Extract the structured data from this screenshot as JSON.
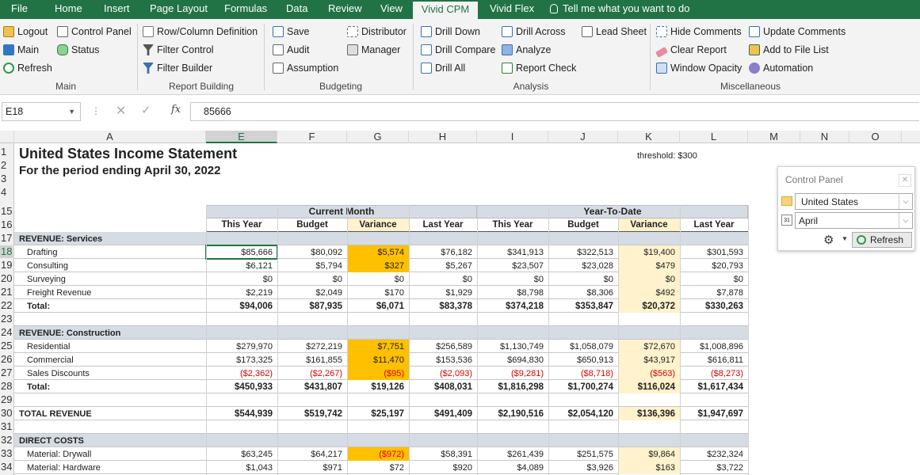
{
  "menubar": {
    "tabs": [
      "File",
      "Home",
      "Insert",
      "Page Layout",
      "Formulas",
      "Data",
      "Review",
      "View",
      "Vivid CPM",
      "Vivid Flex"
    ],
    "active_tab": "Vivid CPM",
    "tell_me": "Tell me what you want to do"
  },
  "ribbon": {
    "main": {
      "logout": "Logout",
      "main": "Main",
      "refresh": "Refresh",
      "control_panel": "Control Panel",
      "status": "Status",
      "group": "Main"
    },
    "report_building": {
      "row_col": "Row/Column Definition",
      "filter_control": "Filter Control",
      "filter_builder": "Filter Builder",
      "group": "Report Building"
    },
    "budgeting": {
      "save": "Save",
      "audit": "Audit",
      "assumption": "Assumption",
      "distributor": "Distributor",
      "manager": "Manager",
      "group": "Budgeting"
    },
    "analysis": {
      "drill_down": "Drill Down",
      "drill_compare": "Drill Compare",
      "drill_all": "Drill All",
      "drill_across": "Drill Across",
      "analyze": "Analyze",
      "report_check": "Report Check",
      "lead_sheet": "Lead Sheet",
      "group": "Analysis"
    },
    "misc": {
      "hide_comments": "Hide Comments",
      "clear_report": "Clear Report",
      "window_opacity": "Window Opacity",
      "update_comments": "Update Comments",
      "add_to_file_list": "Add to File List",
      "automation": "Automation",
      "group": "Miscellaneous"
    }
  },
  "formula_bar": {
    "name_box": "E18",
    "formula": "85666"
  },
  "columns": [
    "A",
    "E",
    "F",
    "G",
    "H",
    "I",
    "J",
    "K",
    "L",
    "M",
    "N",
    "O"
  ],
  "row_numbers": [
    "1",
    "2",
    "3",
    "4",
    "15",
    "16",
    "17",
    "18",
    "19",
    "20",
    "21",
    "22",
    "23",
    "24",
    "25",
    "26",
    "27",
    "28",
    "29",
    "30",
    "31",
    "32",
    "33",
    "34"
  ],
  "report": {
    "title": "United States Income Statement",
    "subtitle": "For the period ending April 30, 2022",
    "threshold": "threshold:  $300",
    "current_month": "Current Month",
    "ytd": "Year-To-Date",
    "col_headers": [
      "This Year",
      "Budget",
      "Variance",
      "Last Year",
      "This Year",
      "Budget",
      "Variance",
      "Last Year"
    ]
  },
  "rows": [
    {
      "label": "REVENUE: Services",
      "kind": "section"
    },
    {
      "label": "Drafting",
      "values": [
        "$85,666",
        "$80,092",
        "$5,574",
        "$76,182",
        "$341,913",
        "$322,513",
        "$19,400",
        "$301,593"
      ]
    },
    {
      "label": "Consulting",
      "values": [
        "$6,121",
        "$5,794",
        "$327",
        "$5,267",
        "$23,507",
        "$23,028",
        "$479",
        "$20,793"
      ]
    },
    {
      "label": "Surveying",
      "values": [
        "$0",
        "$0",
        "$0",
        "$0",
        "$0",
        "$0",
        "$0",
        "$0"
      ]
    },
    {
      "label": "Freight Revenue",
      "values": [
        "$2,219",
        "$2,049",
        "$170",
        "$1,929",
        "$8,798",
        "$8,306",
        "$492",
        "$7,878"
      ]
    },
    {
      "label": "Total:",
      "kind": "total",
      "values": [
        "$94,006",
        "$87,935",
        "$6,071",
        "$83,378",
        "$374,218",
        "$353,847",
        "$20,372",
        "$330,263"
      ]
    },
    {
      "label": "",
      "kind": "blank"
    },
    {
      "label": "REVENUE: Construction",
      "kind": "section"
    },
    {
      "label": "Residential",
      "values": [
        "$279,970",
        "$272,219",
        "$7,751",
        "$256,589",
        "$1,130,749",
        "$1,058,079",
        "$72,670",
        "$1,008,896"
      ]
    },
    {
      "label": "Commercial",
      "values": [
        "$173,325",
        "$161,855",
        "$11,470",
        "$153,536",
        "$694,830",
        "$650,913",
        "$43,917",
        "$616,811"
      ]
    },
    {
      "label": "Sales Discounts",
      "kind": "neg",
      "values": [
        "($2,362)",
        "($2,267)",
        "($95)",
        "($2,093)",
        "($9,281)",
        "($8,718)",
        "($563)",
        "($8,273)"
      ]
    },
    {
      "label": "Total:",
      "kind": "total",
      "values": [
        "$450,933",
        "$431,807",
        "$19,126",
        "$408,031",
        "$1,816,298",
        "$1,700,274",
        "$116,024",
        "$1,617,434"
      ]
    },
    {
      "label": "",
      "kind": "blank"
    },
    {
      "label": "TOTAL REVENUE",
      "kind": "grand",
      "values": [
        "$544,939",
        "$519,742",
        "$25,197",
        "$491,409",
        "$2,190,516",
        "$2,054,120",
        "$136,396",
        "$1,947,697"
      ]
    },
    {
      "label": "",
      "kind": "blank"
    },
    {
      "label": "DIRECT COSTS",
      "kind": "section"
    },
    {
      "label": "Material: Drywall",
      "values": [
        "$63,245",
        "$64,217",
        "($972)",
        "$58,391",
        "$261,439",
        "$251,575",
        "$9,864",
        "$232,324"
      ],
      "neg_cols": [
        2
      ]
    },
    {
      "label": "Material: Hardware",
      "values": [
        "$1,043",
        "$971",
        "$72",
        "$920",
        "$4,089",
        "$3,926",
        "$163",
        "$3,722"
      ]
    }
  ],
  "highlights": {
    "orange": "#ffc000",
    "light_yellow": "#fff2cc",
    "header_blue": "#d9e1f2",
    "neg_red": "#e00000"
  },
  "control_panel": {
    "title": "Control Panel",
    "entity": "United States",
    "period": "April",
    "refresh": "Refresh",
    "calendar_label": "31"
  }
}
